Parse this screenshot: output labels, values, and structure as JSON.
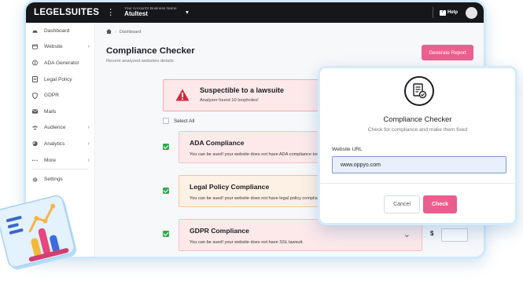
{
  "topbar": {
    "logo": "LEGELSUITES",
    "account_label": "Your Account's Business Name",
    "account_name": "Atultest",
    "help_label": "Help"
  },
  "sidebar": {
    "items": [
      {
        "label": "Dashboard",
        "icon": "dashboard-icon",
        "has_chevron": false
      },
      {
        "label": "Website",
        "icon": "website-icon",
        "has_chevron": true
      },
      {
        "label": "ADA Generator",
        "icon": "ada-icon",
        "has_chevron": false
      },
      {
        "label": "Legal Policy",
        "icon": "document-icon",
        "has_chevron": false
      },
      {
        "label": "GDPR",
        "icon": "shield-icon",
        "has_chevron": false
      },
      {
        "label": "Mails",
        "icon": "mail-icon",
        "has_chevron": false
      },
      {
        "label": "Audience",
        "icon": "audience-icon",
        "has_chevron": true
      },
      {
        "label": "Analytics",
        "icon": "analytics-icon",
        "has_chevron": true
      },
      {
        "label": "More",
        "icon": "more-icon",
        "has_chevron": true
      },
      {
        "label": "Settings",
        "icon": "gear-icon",
        "has_chevron": false
      }
    ]
  },
  "breadcrumb": {
    "current": "Dashboard"
  },
  "page": {
    "title": "Compliance Checker",
    "subtitle": "Recent analyzed websites details",
    "generate_label": "Generate Report"
  },
  "alert": {
    "title": "Suspectible to a lawsuite",
    "subtitle": "Analyzer found 10 loopholes!"
  },
  "select_all_label": "Select All",
  "cards": [
    {
      "title": "ADA Compliance",
      "desc": "You can be sued! your website does not have ADA compliance tool.",
      "tone": "red"
    },
    {
      "title": "Legal Policy Compliance",
      "desc": "You can be sued! your website does not have legal policy compliance tool.",
      "tone": "orange"
    },
    {
      "title": "GDPR Compliance",
      "desc": "You can be sued! your website does not have SSL lawsuit.",
      "tone": "red"
    }
  ],
  "price_symbol": "$",
  "modal": {
    "title": "Compliance Checker",
    "subtitle": "Check for compliance and make them fixed",
    "field_label": "Website URL",
    "field_value": "www.oppyo.com",
    "cancel_label": "Cancel",
    "check_label": "Check"
  },
  "colors": {
    "accent": "#ea5d8d",
    "topbar": "#16171b",
    "alert_bg": "#fde9ea",
    "check_green": "#2fa84f"
  }
}
